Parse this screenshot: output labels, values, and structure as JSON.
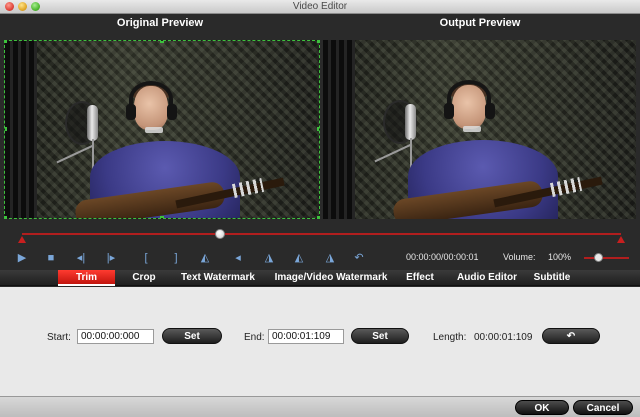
{
  "window": {
    "title": "Video Editor"
  },
  "preview": {
    "original_label": "Original Preview",
    "output_label": "Output Preview"
  },
  "timeline": {
    "position_fraction": 0.33
  },
  "player": {
    "time_readout": "00:00:00/00:00:01",
    "volume_label": "Volume:",
    "volume_value": "100%",
    "volume_fraction": 0.3,
    "buttons": [
      {
        "name": "play-icon",
        "glyph": "▶"
      },
      {
        "name": "stop-icon",
        "glyph": "■"
      },
      {
        "name": "prev-frame-icon",
        "glyph": "◂|"
      },
      {
        "name": "next-frame-icon",
        "glyph": "|▸"
      },
      {
        "name": "mark-in-icon",
        "glyph": "["
      },
      {
        "name": "mark-out-icon",
        "glyph": "]"
      },
      {
        "name": "flip-horizontal-icon",
        "glyph": "◭"
      },
      {
        "name": "rotate-left-icon",
        "glyph": "◂"
      },
      {
        "name": "flip-vertical-icon",
        "glyph": "◮"
      },
      {
        "name": "mirror-left-icon",
        "glyph": "◭"
      },
      {
        "name": "mirror-right-icon",
        "glyph": "◮"
      },
      {
        "name": "undo-icon",
        "glyph": "↶"
      }
    ]
  },
  "tabs": [
    {
      "label": "Trim",
      "active": true
    },
    {
      "label": "Crop",
      "active": false
    },
    {
      "label": "Text Watermark",
      "active": false
    },
    {
      "label": "Image/Video Watermark",
      "active": false
    },
    {
      "label": "Effect",
      "active": false
    },
    {
      "label": "Audio Editor",
      "active": false
    },
    {
      "label": "Subtitle",
      "active": false
    }
  ],
  "trim": {
    "start_label": "Start:",
    "start_value": "00:00:00:000",
    "set_label": "Set",
    "end_label": "End:",
    "end_value": "00:00:01:109",
    "length_label": "Length:",
    "length_value": "00:00:01:109",
    "reset_icon": "↶"
  },
  "dialog": {
    "ok_label": "OK",
    "cancel_label": "Cancel"
  },
  "colors": {
    "accent_red": "#c81f1f",
    "crop_green": "#3dc23d",
    "tab_active": "#e0281f"
  }
}
